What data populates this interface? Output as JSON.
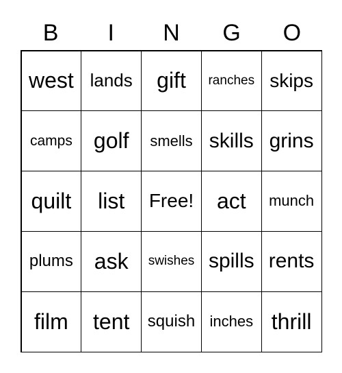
{
  "header": [
    "B",
    "I",
    "N",
    "G",
    "O"
  ],
  "cells": [
    "west",
    "lands",
    "gift",
    "ranches",
    "skips",
    "camps",
    "golf",
    "smells",
    "skills",
    "grins",
    "quilt",
    "list",
    "Free!",
    "act",
    "munch",
    "plums",
    "ask",
    "swishes",
    "spills",
    "rents",
    "film",
    "tent",
    "squish",
    "inches",
    "thrill"
  ]
}
